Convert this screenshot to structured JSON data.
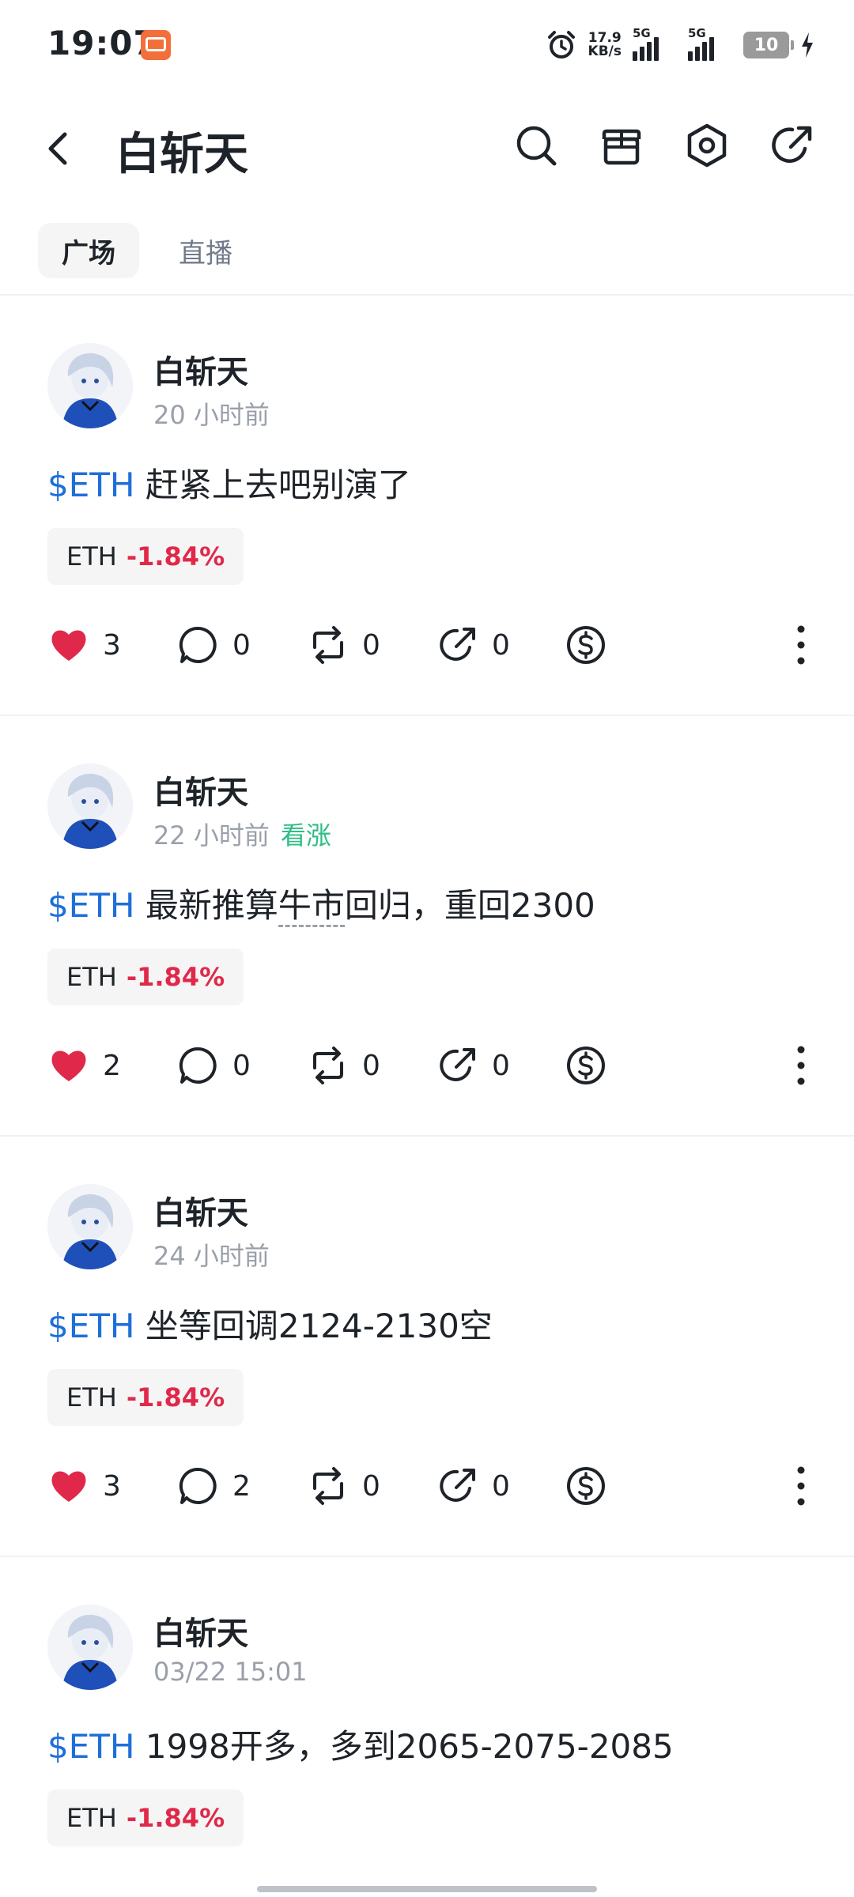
{
  "status_bar": {
    "time": "19:07",
    "net_speed_value": "17.9",
    "net_speed_unit": "KB/s",
    "signal_1": "5G",
    "signal_2": "5G",
    "battery": "10",
    "icons": [
      "app-badge-icon",
      "alarm-icon",
      "signal-icon",
      "battery-icon",
      "charging-icon"
    ]
  },
  "header": {
    "title": "白斩天",
    "icons": [
      "back-icon",
      "search-icon",
      "gift-icon",
      "settings-icon",
      "share-icon"
    ]
  },
  "tabs": [
    {
      "label": "广场",
      "active": true
    },
    {
      "label": "直播",
      "active": false
    }
  ],
  "posts": [
    {
      "author": "白斩天",
      "time": "20 小时前",
      "sentiment": "",
      "ticker": "$ETH",
      "text": "赶紧上去吧别演了",
      "chip_symbol": "ETH",
      "chip_change": "-1.84%",
      "likes": "3",
      "comments": "0",
      "reposts": "0",
      "shares": "0"
    },
    {
      "author": "白斩天",
      "time": "22 小时前",
      "sentiment": "看涨",
      "ticker": "$ETH",
      "text_before": "最新推算",
      "text_dotted": "牛市",
      "text_after": "回归，重回2300",
      "chip_symbol": "ETH",
      "chip_change": "-1.84%",
      "likes": "2",
      "comments": "0",
      "reposts": "0",
      "shares": "0"
    },
    {
      "author": "白斩天",
      "time": "24 小时前",
      "sentiment": "",
      "ticker": "$ETH",
      "text": "坐等回调2124-2130空",
      "chip_symbol": "ETH",
      "chip_change": "-1.84%",
      "likes": "3",
      "comments": "2",
      "reposts": "0",
      "shares": "0"
    },
    {
      "author": "白斩天",
      "time": "03/22 15:01",
      "sentiment": "",
      "ticker": "$ETH",
      "text": "1998开多，多到2065-2075-2085",
      "chip_symbol": "ETH",
      "chip_change": "-1.84%"
    }
  ],
  "colors": {
    "ticker": "#1e6fd9",
    "negative": "#e0294a",
    "bullish": "#2ebd85",
    "like": "#e0294a"
  }
}
